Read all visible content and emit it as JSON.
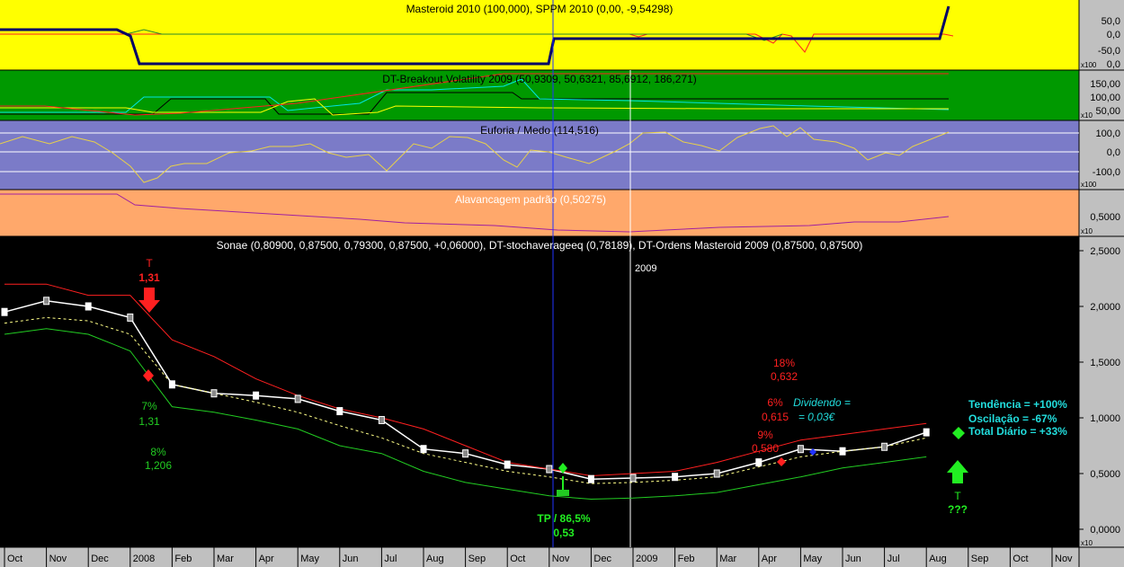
{
  "colors": {
    "panel1_bg": "#ffff00",
    "panel2_bg": "#009900",
    "panel3_bg": "#7b7bc8",
    "panel4_bg": "#ffa86b",
    "main_bg": "#000000",
    "axis_bg": "#c0c0c0",
    "upper_band": "#ff2020",
    "lower_band": "#22cc22",
    "midline": "#ffff88",
    "buy_green": "#22ee22",
    "sell_red": "#ff2020",
    "info_cyan": "#22dddd",
    "cursor_blue": "#2233ff"
  },
  "panels": {
    "masteroid": {
      "title": "Masteroid 2010 (100,000), SPPM 2010 (0,00, -9,54298)",
      "ticks": [
        "50,0",
        "0,0",
        "-50,0",
        "0,0"
      ],
      "scale": "x100"
    },
    "breakout": {
      "title": "DT-Breakout Volatility 2009 (50,9309, 50,6321, 85,6912, 186,271)",
      "ticks": [
        "150,00",
        "100,00",
        "50,00"
      ],
      "scale": "x10"
    },
    "euforia": {
      "title": "Euforia / Medo (114,516)",
      "ticks": [
        "100,0",
        "0,0",
        "-100,0"
      ],
      "scale": "x100"
    },
    "alavancagem": {
      "title": "Alavancagem padrão (0,50275)",
      "ticks": [
        "0,5000"
      ],
      "scale": "x10"
    },
    "main": {
      "title": "Sonae (0,80900, 0,87500, 0,79300, 0,87500, +0,06000), DT-stochaverageeq (0,78189), DT-Ordens Masteroid 2009 (0,87500, 0,87500)",
      "ticks": [
        "2,5000",
        "2,0000",
        "1,5000",
        "1,0000",
        "0,5000",
        "0,0000"
      ],
      "scale": "x10",
      "year_marker": "2009"
    }
  },
  "x_axis": {
    "labels": [
      "Oct",
      "Nov",
      "Dec",
      "2008",
      "Feb",
      "Mar",
      "Apr",
      "May",
      "Jun",
      "Jul",
      "Aug",
      "Sep",
      "Oct",
      "Nov",
      "Dec",
      "2009",
      "Feb",
      "Mar",
      "Apr",
      "May",
      "Jun",
      "Jul",
      "Aug",
      "Sep",
      "Oct",
      "Nov"
    ]
  },
  "annotations": {
    "sell_t": "T",
    "sell_price": "1,31",
    "buy1_pct": "7%",
    "buy1_price": "1,31",
    "buy2_pct": "8%",
    "buy2_price": "1,206",
    "tp_label": "TP / 86,5%",
    "tp_price": "0,53",
    "a18_pct": "18%",
    "a18_price": "0,632",
    "a6_pct": "6%",
    "a6_price": "0,615",
    "a9_pct": "9%",
    "a9_price": "0,580",
    "div_label": "Dividendo =",
    "div_value": "= 0,03€",
    "tendencia": "Tendência = +100%",
    "oscilacao": "Oscilação = -67%",
    "total": "Total Diário = +33%",
    "t_future": "T",
    "t_future_q": "???"
  },
  "chart_data": {
    "type": "line",
    "x": [
      "Oct",
      "Nov",
      "Dec",
      "2008",
      "Feb",
      "Mar",
      "Apr",
      "May",
      "Jun",
      "Jul",
      "Aug",
      "Sep",
      "Oct",
      "Nov",
      "Dec",
      "2009",
      "Feb",
      "Mar",
      "Apr",
      "May",
      "Jun",
      "Jul",
      "Aug"
    ],
    "series": [
      {
        "values": [
          1.95,
          2.05,
          2.0,
          1.9,
          1.3,
          1.22,
          1.2,
          1.17,
          1.06,
          0.98,
          0.72,
          0.68,
          0.58,
          0.54,
          0.45,
          0.46,
          0.47,
          0.5,
          0.6,
          0.72,
          0.7,
          0.74,
          0.87
        ]
      },
      {
        "values": [
          2.2,
          2.2,
          2.1,
          2.1,
          1.7,
          1.55,
          1.35,
          1.2,
          1.08,
          1.0,
          0.9,
          0.75,
          0.6,
          0.54,
          0.48,
          0.5,
          0.52,
          0.6,
          0.7,
          0.8,
          0.85,
          0.9,
          0.95
        ]
      },
      {
        "values": [
          1.75,
          1.8,
          1.75,
          1.6,
          1.1,
          1.05,
          0.98,
          0.9,
          0.75,
          0.68,
          0.52,
          0.42,
          0.36,
          0.3,
          0.27,
          0.28,
          0.3,
          0.33,
          0.4,
          0.47,
          0.55,
          0.6,
          0.65
        ]
      },
      {
        "values": [
          1.85,
          1.9,
          1.87,
          1.75,
          1.3,
          1.22,
          1.14,
          1.05,
          0.93,
          0.82,
          0.68,
          0.6,
          0.52,
          0.47,
          0.41,
          0.42,
          0.44,
          0.47,
          0.56,
          0.65,
          0.7,
          0.74,
          0.82
        ]
      }
    ],
    "ylim": [
      0,
      2.5
    ]
  }
}
